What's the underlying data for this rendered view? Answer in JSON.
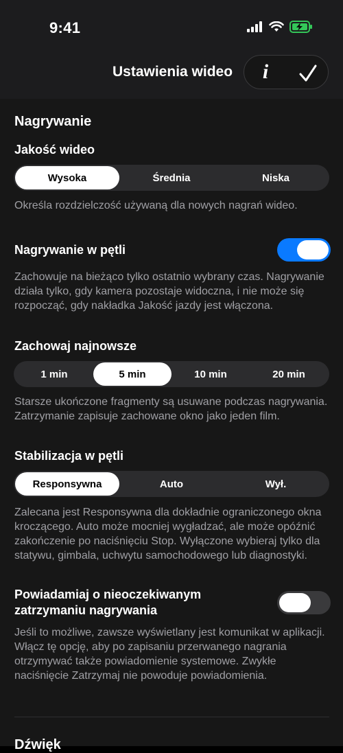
{
  "status_bar": {
    "time": "9:41"
  },
  "nav": {
    "title": "Ustawienia wideo",
    "info_glyph": "i"
  },
  "recording": {
    "section_title": "Nagrywanie",
    "quality": {
      "label": "Jakość wideo",
      "options": [
        "Wysoka",
        "Średnia",
        "Niska"
      ],
      "selected": "Wysoka",
      "description": "Określa rozdzielczość używaną dla nowych nagrań wideo."
    },
    "loop": {
      "label": "Nagrywanie w pętli",
      "enabled": true,
      "description": "Zachowuje na bieżąco tylko ostatnio wybrany czas. Nagrywanie działa tylko, gdy kamera pozostaje widoczna, i nie może się rozpocząć, gdy nakładka Jakość jazdy jest włączona."
    },
    "keep_latest": {
      "label": "Zachowaj najnowsze",
      "options": [
        "1 min",
        "5 min",
        "10 min",
        "20 min"
      ],
      "selected": "5 min",
      "description": "Starsze ukończone fragmenty są usuwane podczas nagrywania. Zatrzymanie zapisuje zachowane okno jako jeden film."
    },
    "stabilization": {
      "label": "Stabilizacja w pętli",
      "options": [
        "Responsywna",
        "Auto",
        "Wył."
      ],
      "selected": "Responsywna",
      "description": "Zalecana jest Responsywna dla dokładnie ograniczonego okna kroczącego. Auto może mocniej wygładzać, ale może opóźnić zakończenie po naciśnięciu Stop. Wyłączone wybieraj tylko dla statywu, gimbala, uchwytu samochodowego lub diagnostyki."
    },
    "notify": {
      "label_line1": "Powiadamiaj o nieoczekiwanym",
      "label_line2": "zatrzymaniu nagrywania",
      "enabled": false,
      "description": "Jeśli to możliwe, zawsze wyświetlany jest komunikat w aplikacji. Włącz tę opcję, aby po zapisaniu przerwanego nagrania otrzymywać także powiadomienie systemowe. Zwykłe naciśnięcie Zatrzymaj nie powoduje powiadomienia."
    }
  },
  "sound": {
    "section_title": "Dźwięk"
  },
  "colors": {
    "accent": "#0a7aff",
    "battery": "#34c759"
  }
}
